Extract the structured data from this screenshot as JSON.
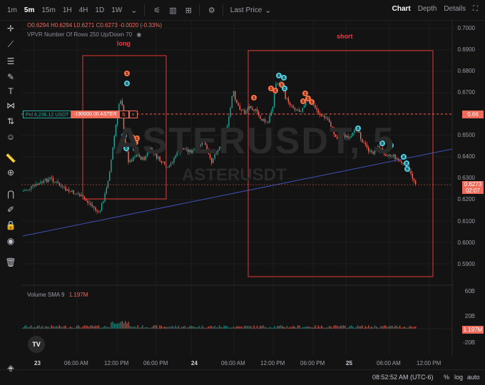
{
  "toolbar": {
    "timeframes": [
      "1m",
      "5m",
      "15m",
      "1H",
      "4H",
      "1D",
      "1W"
    ],
    "active_timeframe": "5m",
    "price_source": "Last Price",
    "tabs": [
      "Chart",
      "Depth",
      "Details"
    ],
    "active_tab": "Chart"
  },
  "legend": {
    "o": "O0.6294",
    "h": "H0.6294",
    "l": "L0.6271",
    "c": "C0.6273",
    "change": "-0.0020 (-0.33%)",
    "vpvr": "VPVR Number Of Rows 250 Up/Down 70"
  },
  "symbol_watermark": "ASTERUSDT, 5",
  "symbol_sub": "ASTERUSDT",
  "annotations": {
    "long": "long",
    "short": "short"
  },
  "order": {
    "pnl": "Pnl 6,236.12 USDT",
    "qty": "-190000.00 ASTER",
    "arrows": "⇅",
    "close": "×"
  },
  "price_axis": [
    "0.7000",
    "0.6900",
    "0.6800",
    "0.6700",
    "0.6500",
    "0.6400",
    "0.6300",
    "0.6200",
    "0.6100",
    "0.6000",
    "0.5900"
  ],
  "order_price_tag": "0.66",
  "last_price_tag": "0.6273",
  "last_price_countdown": "02:07",
  "volume": {
    "legend": "Volume SMA 9",
    "value": "1.197M",
    "axis": [
      "60B",
      "20B",
      "-20B"
    ],
    "tag": "1.197M"
  },
  "time_axis": [
    {
      "label": "23",
      "bold": true
    },
    {
      "label": "06:00 AM",
      "bold": false
    },
    {
      "label": "12:00 PM",
      "bold": false
    },
    {
      "label": "06:00 PM",
      "bold": false
    },
    {
      "label": "24",
      "bold": true
    },
    {
      "label": "06:00 AM",
      "bold": false
    },
    {
      "label": "12:00 PM",
      "bold": false
    },
    {
      "label": "06:00 PM",
      "bold": false
    },
    {
      "label": "25",
      "bold": true
    },
    {
      "label": "06:00 AM",
      "bold": false
    },
    {
      "label": "12:00 PM",
      "bold": false
    }
  ],
  "bottom": {
    "time": "08:52:52 AM (UTC-6)",
    "pct": "%",
    "log": "log",
    "auto": "auto"
  },
  "colors": {
    "up": "#26a69a",
    "down": "#f06a5a",
    "buy": "#4dd0e1",
    "sell": "#ff7043",
    "box": "#e53935",
    "trend": "#3f51b5"
  },
  "logo": "TV"
}
